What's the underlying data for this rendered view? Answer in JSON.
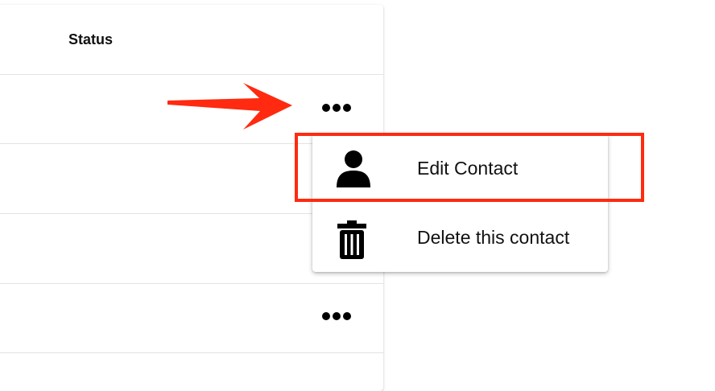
{
  "table": {
    "status_header": "Status"
  },
  "context_menu": {
    "items": [
      {
        "label": "Edit Contact",
        "icon": "person-icon"
      },
      {
        "label": "Delete this contact",
        "icon": "trash-icon"
      }
    ]
  },
  "annotations": {
    "highlight_color": "#ff2a10",
    "arrow_color": "#ff2a10"
  }
}
